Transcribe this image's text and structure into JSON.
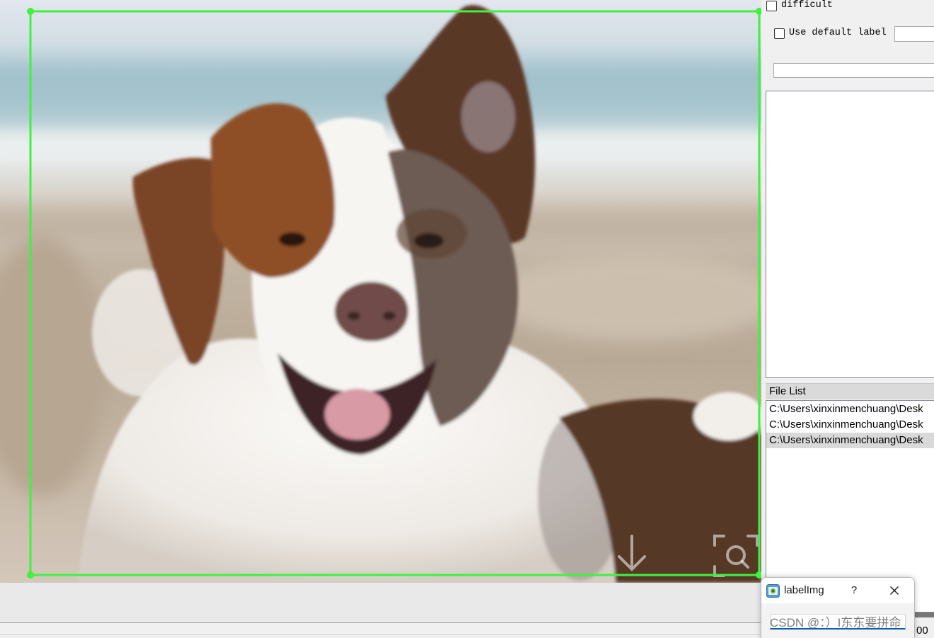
{
  "colors": {
    "bounding_box": "#3ef23e",
    "file_selected_bg": "#d9d9d9",
    "input_focus": "#005fb8"
  },
  "canvas": {
    "overlay_icons": [
      "download-icon",
      "zoom-search-icon"
    ]
  },
  "panel": {
    "difficult": {
      "label": "difficult",
      "checked": false
    },
    "use_default_label": {
      "label": "Use default label",
      "checked": false,
      "value": ""
    },
    "label_filter": {
      "value": ""
    },
    "label_list": {
      "items": []
    },
    "file_list": {
      "title": "File List",
      "items": [
        {
          "path": "C:\\Users\\xinxinmenchuang\\Desk",
          "selected": false
        },
        {
          "path": "C:\\Users\\xinxinmenchuang\\Desk",
          "selected": false
        },
        {
          "path": "C:\\Users\\xinxinmenchuang\\Desk",
          "selected": true
        }
      ]
    }
  },
  "dialog": {
    "title": "labelImg",
    "app_icon": "labelimg-app-icon",
    "help_label": "?",
    "close_icon": "close-icon",
    "input_value": ""
  },
  "watermark": {
    "text": "CSDN @：）I东东要拼命"
  },
  "status_bar": {
    "text": "00"
  }
}
